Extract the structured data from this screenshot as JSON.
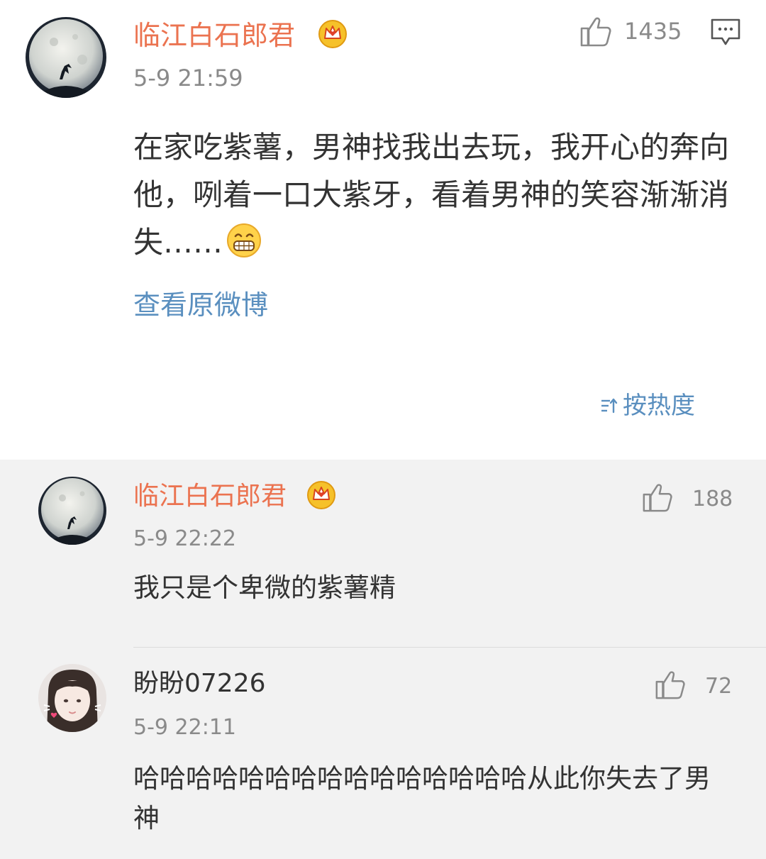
{
  "main_comment": {
    "username": "临江白石郎君",
    "time": "5-9 21:59",
    "like_count": "1435",
    "text": "在家吃紫薯，男神找我出去玩，我开心的奔向他，咧着一口大紫牙，看着男神的笑容渐渐消失……",
    "emoji": "grin-emoji",
    "view_original_label": "查看原微博"
  },
  "sort": {
    "label": "按热度"
  },
  "replies": [
    {
      "username": "临江白石郎君",
      "time": "5-9 22:22",
      "like_count": "188",
      "text": "我只是个卑微的紫薯精"
    },
    {
      "username": "盼盼07226",
      "time": "5-9 22:11",
      "like_count": "72",
      "text": "哈哈哈哈哈哈哈哈哈哈哈哈哈哈哈从此你失去了男神"
    }
  ],
  "colors": {
    "vip_username": "#eb7350",
    "link": "#5a8fbf",
    "meta_gray": "#8a8a8a",
    "reply_background": "#f2f2f2"
  }
}
